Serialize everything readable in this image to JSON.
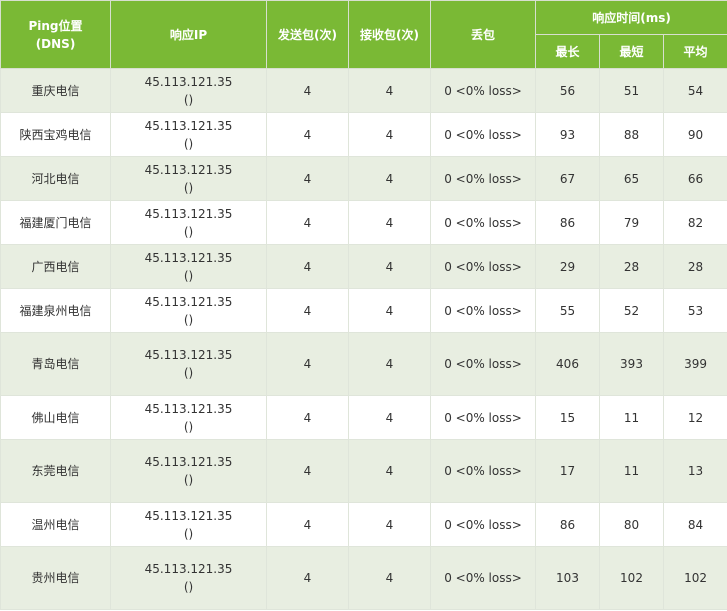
{
  "header": {
    "location": "Ping位置\n(DNS)",
    "ip": "响应IP",
    "sent": "发送包(次)",
    "received": "接收包(次)",
    "loss": "丢包",
    "response_time": "响应时间(ms)",
    "max": "最长",
    "min": "最短",
    "avg": "平均"
  },
  "rows": [
    {
      "location": "重庆电信",
      "ip": "45.113.121.35",
      "paren": "()",
      "sent": "4",
      "received": "4",
      "loss": "0 <0% loss>",
      "max": "56",
      "min": "51",
      "avg": "54"
    },
    {
      "location": "陕西宝鸡电信",
      "ip": "45.113.121.35",
      "paren": "()",
      "sent": "4",
      "received": "4",
      "loss": "0 <0% loss>",
      "max": "93",
      "min": "88",
      "avg": "90"
    },
    {
      "location": "河北电信",
      "ip": "45.113.121.35",
      "paren": "()",
      "sent": "4",
      "received": "4",
      "loss": "0 <0% loss>",
      "max": "67",
      "min": "65",
      "avg": "66"
    },
    {
      "location": "福建厦门电信",
      "ip": "45.113.121.35",
      "paren": "()",
      "sent": "4",
      "received": "4",
      "loss": "0 <0% loss>",
      "max": "86",
      "min": "79",
      "avg": "82"
    },
    {
      "location": "广西电信",
      "ip": "45.113.121.35",
      "paren": "()",
      "sent": "4",
      "received": "4",
      "loss": "0 <0% loss>",
      "max": "29",
      "min": "28",
      "avg": "28"
    },
    {
      "location": "福建泉州电信",
      "ip": "45.113.121.35",
      "paren": "()",
      "sent": "4",
      "received": "4",
      "loss": "0 <0% loss>",
      "max": "55",
      "min": "52",
      "avg": "53"
    },
    {
      "location": "青岛电信",
      "ip": "45.113.121.35",
      "paren": "()",
      "sent": "4",
      "received": "4",
      "loss": "0 <0% loss>",
      "max": "406",
      "min": "393",
      "avg": "399"
    },
    {
      "location": "佛山电信",
      "ip": "45.113.121.35",
      "paren": "()",
      "sent": "4",
      "received": "4",
      "loss": "0 <0% loss>",
      "max": "15",
      "min": "11",
      "avg": "12"
    },
    {
      "location": "东莞电信",
      "ip": "45.113.121.35",
      "paren": "()",
      "sent": "4",
      "received": "4",
      "loss": "0 <0% loss>",
      "max": "17",
      "min": "11",
      "avg": "13"
    },
    {
      "location": "温州电信",
      "ip": "45.113.121.35",
      "paren": "()",
      "sent": "4",
      "received": "4",
      "loss": "0 <0% loss>",
      "max": "86",
      "min": "80",
      "avg": "84"
    },
    {
      "location": "贵州电信",
      "ip": "45.113.121.35",
      "paren": "()",
      "sent": "4",
      "received": "4",
      "loss": "0 <0% loss>",
      "max": "103",
      "min": "102",
      "avg": "102"
    }
  ],
  "colors": {
    "header_bg": "#7ab935",
    "row_odd_bg": "#e8eee1",
    "row_even_bg": "#ffffff"
  }
}
